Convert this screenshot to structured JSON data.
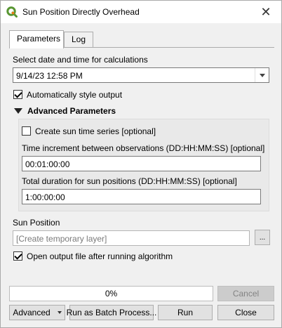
{
  "window": {
    "title": "Sun Position Directly Overhead",
    "close_glyph": "✕"
  },
  "tabs": [
    {
      "label": "Parameters"
    },
    {
      "label": "Log"
    }
  ],
  "params": {
    "datetime_label": "Select date and time for calculations",
    "datetime_value": "9/14/23 12:58 PM",
    "auto_style_label": "Automatically style output",
    "auto_style_checked": true,
    "advanced_label": "Advanced Parameters",
    "sun_series_label": "Create sun time series [optional]",
    "sun_series_checked": false,
    "increment_label": "Time increment between observations (DD:HH:MM:SS) [optional]",
    "increment_value": "00:01:00:00",
    "duration_label": "Total duration for sun positions (DD:HH:MM:SS) [optional]",
    "duration_value": "1:00:00:00",
    "output_label": "Sun Position",
    "output_placeholder": "[Create temporary layer]",
    "browse_label": "...",
    "open_output_label": "Open output file after running algorithm",
    "open_output_checked": true
  },
  "footer": {
    "progress_text": "0%",
    "progress_value": 0,
    "cancel_label": "Cancel",
    "advanced_label": "Advanced",
    "batch_label": "Run as Batch Process...",
    "run_label": "Run",
    "close_label": "Close"
  },
  "icons": {
    "app": "qgis-icon",
    "close": "close-icon"
  },
  "colors": {
    "qgis_green": "#589632",
    "qgis_yellow": "#ee7913"
  }
}
